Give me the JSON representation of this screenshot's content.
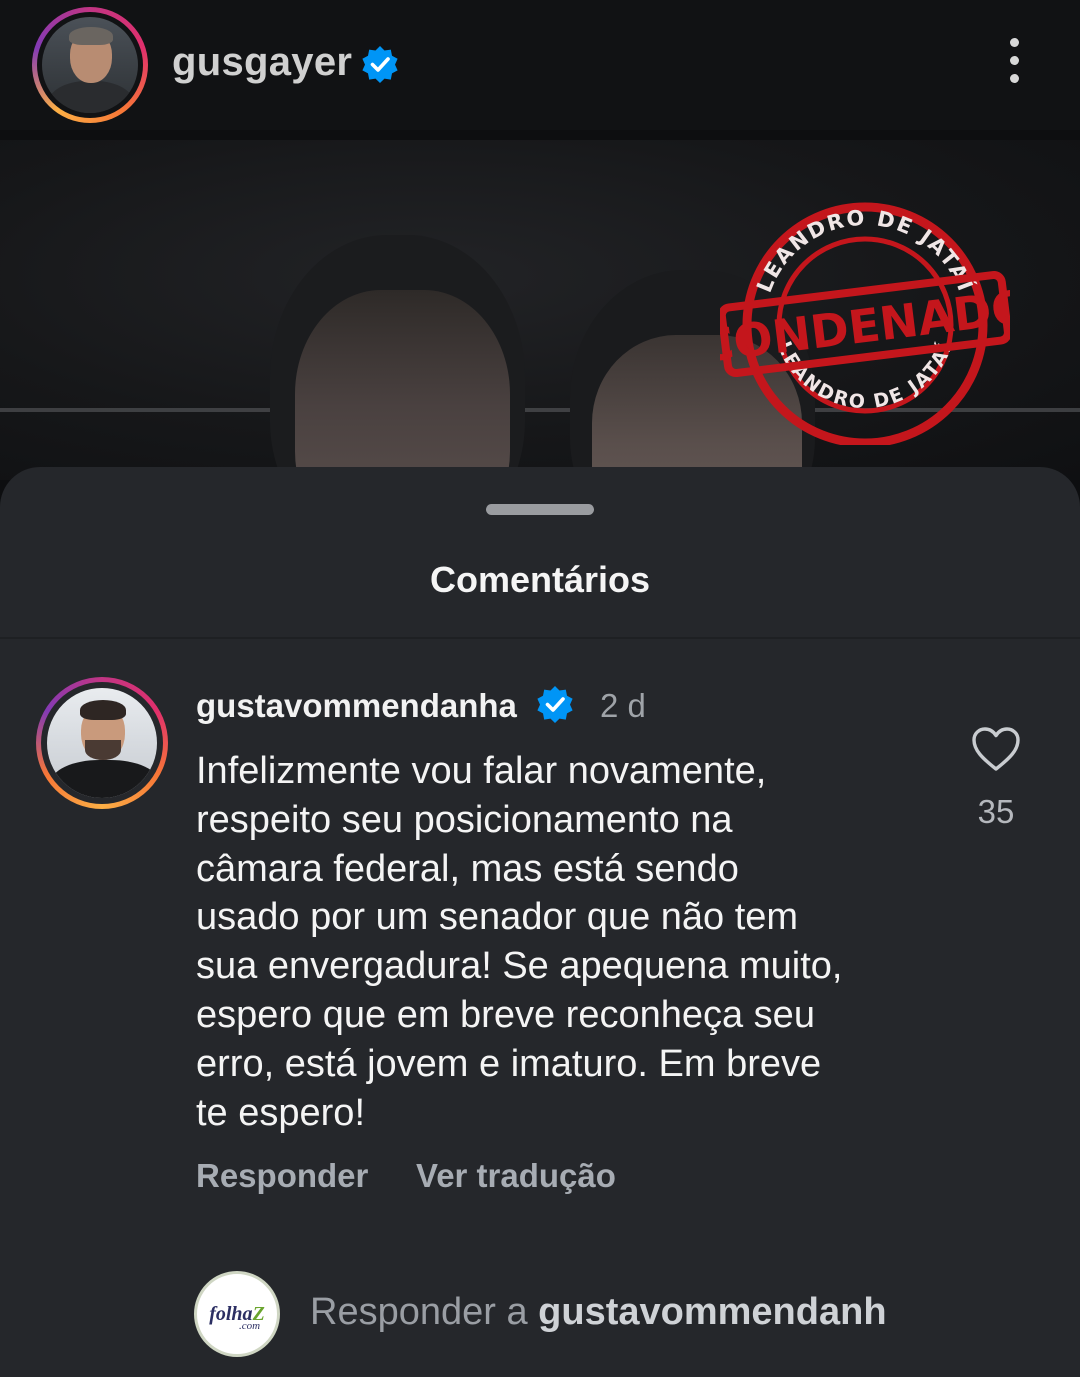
{
  "header": {
    "username": "gusgayer",
    "verified_icon": "verified-badge-icon",
    "menu_icon": "more-options-icon"
  },
  "post": {
    "stamp_top_text": "LEANDRO DE JATAÍ",
    "stamp_center_text": "CONDENADO",
    "stamp_bottom_text": "LEANDRO DE JATAÍ",
    "stamp_color": "#c4161c"
  },
  "comments_sheet": {
    "title": "Comentários",
    "comment": {
      "username": "gustavommendanha",
      "time": "2 d",
      "text_lines": [
        "Infelizmente vou falar novamente,",
        "respeito seu posicionamento na",
        "câmara federal, mas está sendo",
        "usado por um senador que não tem",
        "sua envergadura! Se apequena muito,",
        "espero que em breve reconheça seu",
        "erro, está jovem e imaturo. Em breve",
        "te espero!"
      ],
      "reply_label": "Responder",
      "translate_label": "Ver tradução",
      "like_count": "35",
      "like_icon": "heart-icon"
    },
    "reply_bar": {
      "avatar_logo_main": "folha",
      "avatar_logo_accent": "Z",
      "avatar_logo_sub": ".com",
      "placeholder_prefix": "Responder a",
      "placeholder_user": "gustavommendanh"
    }
  },
  "colors": {
    "background": "#0d0e10",
    "sheet": "#25272b",
    "verified_blue": "#0095f6",
    "secondary_text": "#9fa3a8"
  }
}
